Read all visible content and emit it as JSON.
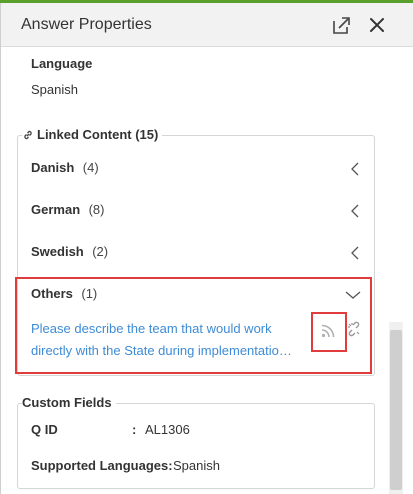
{
  "header": {
    "title": "Answer Properties"
  },
  "language": {
    "label": "Language",
    "value": "Spanish"
  },
  "linked_content": {
    "heading": "Linked Content (15)",
    "groups": [
      {
        "name": "Danish",
        "count": "(4)",
        "state": "collapsed"
      },
      {
        "name": "German",
        "count": "(8)",
        "state": "collapsed"
      },
      {
        "name": "Swedish",
        "count": "(2)",
        "state": "collapsed"
      },
      {
        "name": "Others",
        "count": "(1)",
        "state": "expanded"
      }
    ],
    "item": {
      "line1": "Please describe the team that would work",
      "line2": "directly with the State during implementatio…"
    }
  },
  "custom_fields": {
    "heading": "Custom Fields",
    "q_id_label": "Q ID",
    "colon": ":",
    "q_id_value": "AL1306",
    "supported_languages_label": "Supported Languages:",
    "supported_languages_value": "Spanish"
  },
  "colors": {
    "accent": "#5aa02c",
    "link": "#3d8bd6",
    "highlight": "#e03c3c"
  },
  "icons": [
    "export-icon",
    "close-icon",
    "link-icon",
    "chevron-left-icon",
    "chevron-down-icon",
    "rss-icon",
    "unlink-icon"
  ]
}
